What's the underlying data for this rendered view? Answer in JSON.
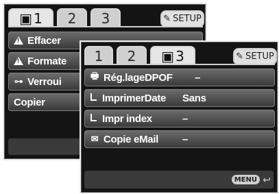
{
  "back_menu": {
    "tabs": [
      {
        "num": "1",
        "icon": "playback-icon"
      },
      {
        "num": "2"
      },
      {
        "num": "3"
      }
    ],
    "setup_label": "SETUP",
    "rows": [
      {
        "label": "Effacer",
        "value": "–",
        "icon": "warning-icon"
      },
      {
        "label": "Formate",
        "value": "",
        "icon": "warning-icon"
      },
      {
        "label": "Verroui",
        "value": "",
        "icon": "key-icon"
      },
      {
        "label": "Copier",
        "value": ""
      }
    ]
  },
  "front_menu": {
    "tabs": [
      {
        "num": "1"
      },
      {
        "num": "2"
      },
      {
        "num": "3",
        "icon": "playback-icon"
      }
    ],
    "setup_label": "SETUP",
    "rows": [
      {
        "label": "Rég.lageDPOF",
        "value": "–",
        "icon": "printer-icon"
      },
      {
        "label": "ImprimerDate",
        "value": "Sans",
        "icon": "sub-item-icon"
      },
      {
        "label": "Impr index",
        "value": "–",
        "icon": "sub-item-icon"
      },
      {
        "label": "Copie eMail",
        "value": "–",
        "icon": "envelope-icon"
      }
    ],
    "menu_label": "MENU"
  }
}
